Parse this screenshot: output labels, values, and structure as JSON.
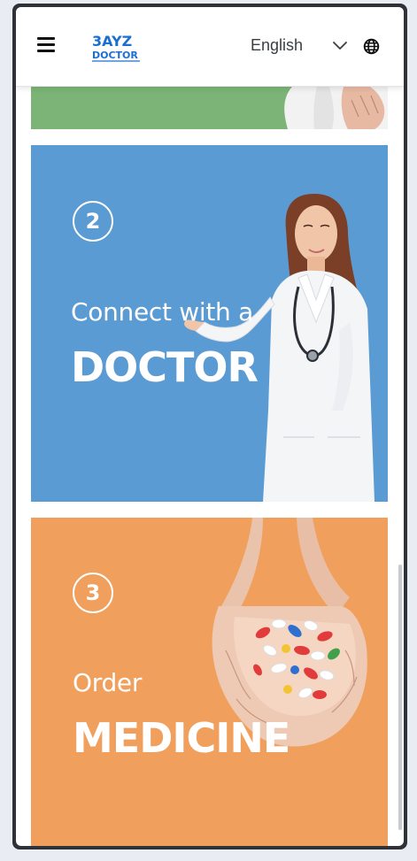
{
  "header": {
    "menu_icon": "hamburger-menu-icon",
    "logo_line1": "3AYZ",
    "logo_line2": "DOCTOR",
    "language": "English",
    "chevron_icon": "chevron-down-icon",
    "globe_icon": "globe-icon"
  },
  "steps": [
    {
      "number": "2",
      "line1": "Connect with a",
      "line2": "DOCTOR"
    },
    {
      "number": "3",
      "line1": "Order",
      "line2": "MEDICINE"
    }
  ],
  "colors": {
    "card1_bg": "#7bb476",
    "card2_bg": "#5b9bd3",
    "card3_bg": "#f0a05c",
    "logo_blue": "#1a6fd1"
  }
}
